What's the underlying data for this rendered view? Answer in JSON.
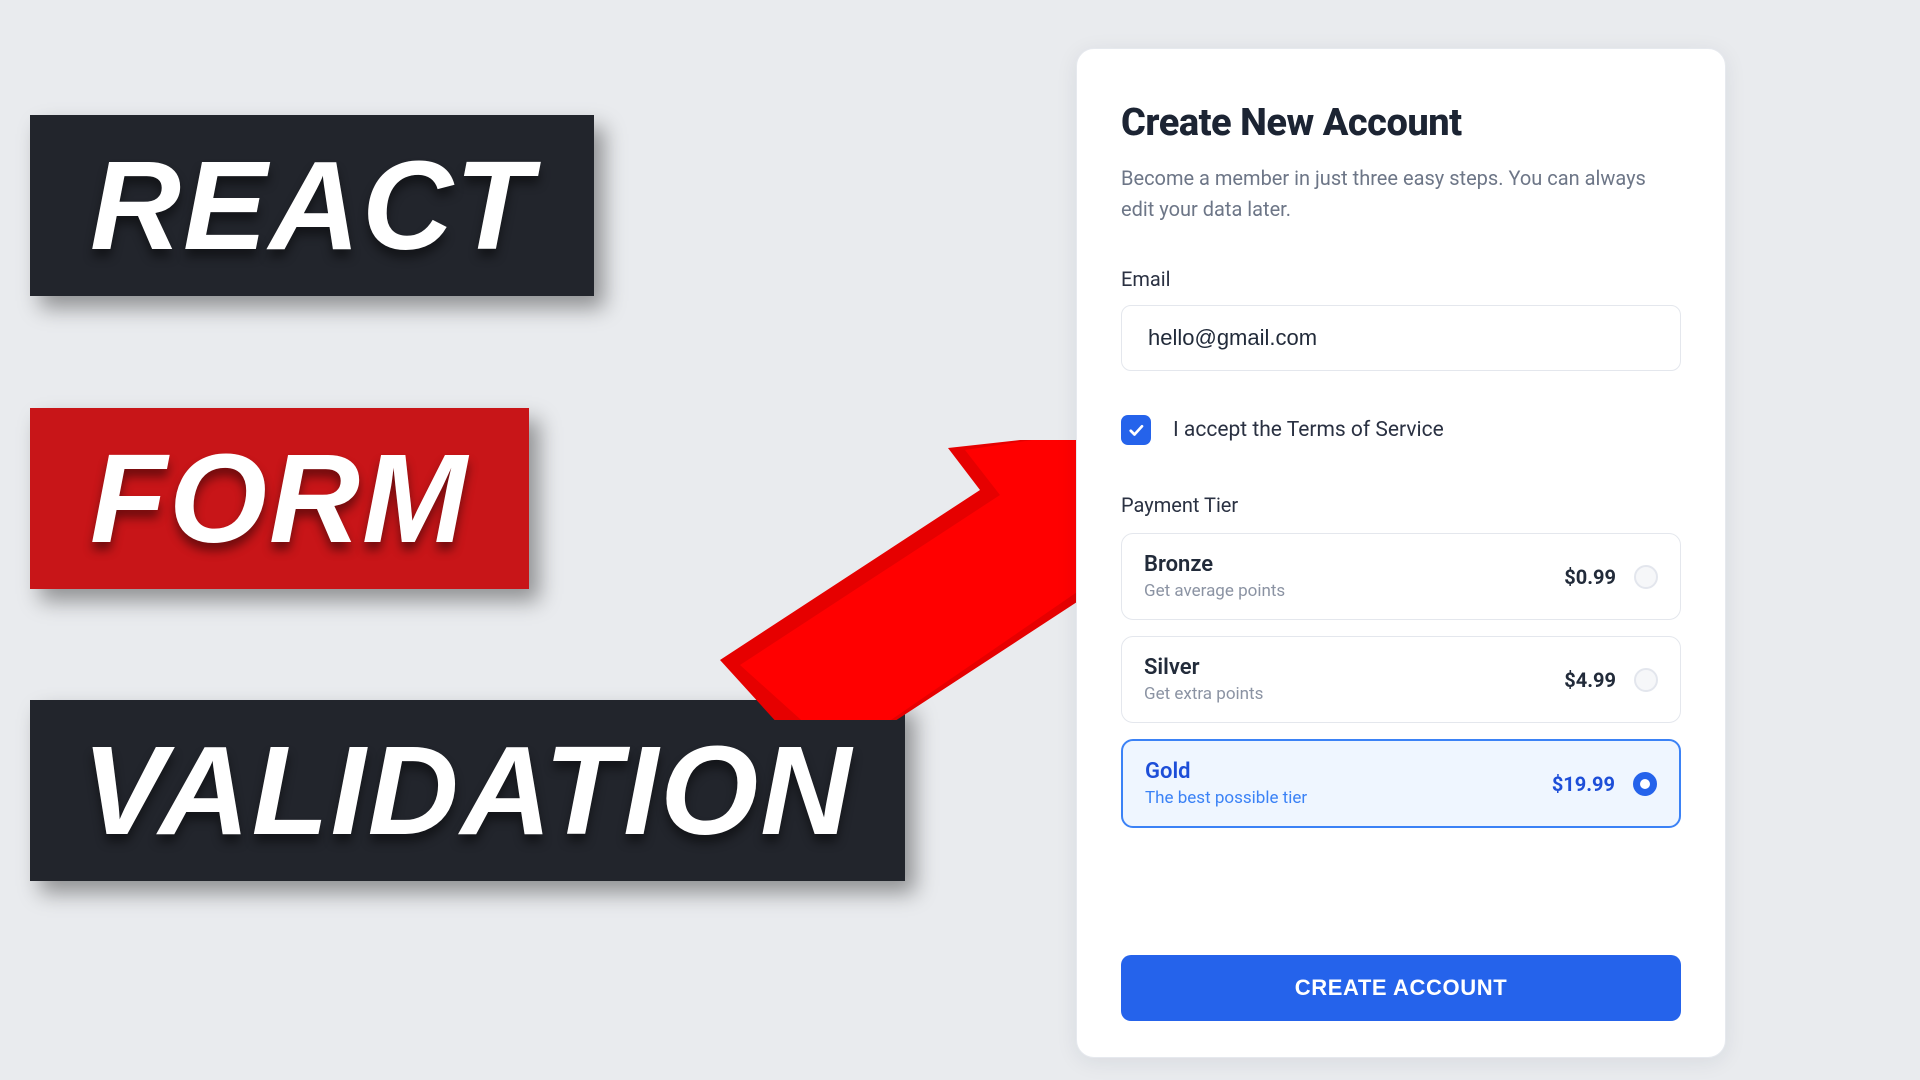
{
  "banners": {
    "line1": "REACT",
    "line2": "FORM",
    "line3": "VALIDATION"
  },
  "form": {
    "title": "Create New Account",
    "subtitle": "Become a member in just three easy steps. You can always edit your data later.",
    "email_label": "Email",
    "email_value": "hello@gmail.com",
    "tos_label": "I accept the Terms of Service",
    "tos_checked": true,
    "tier_label": "Payment Tier",
    "tiers": [
      {
        "name": "Bronze",
        "desc": "Get average points",
        "price": "$0.99",
        "selected": false
      },
      {
        "name": "Silver",
        "desc": "Get extra points",
        "price": "$4.99",
        "selected": false
      },
      {
        "name": "Gold",
        "desc": "The best possible tier",
        "price": "$19.99",
        "selected": true
      }
    ],
    "submit_label": "CREATE ACCOUNT"
  },
  "colors": {
    "accent": "#2563eb",
    "red": "#c81518",
    "dark": "#22252c"
  }
}
